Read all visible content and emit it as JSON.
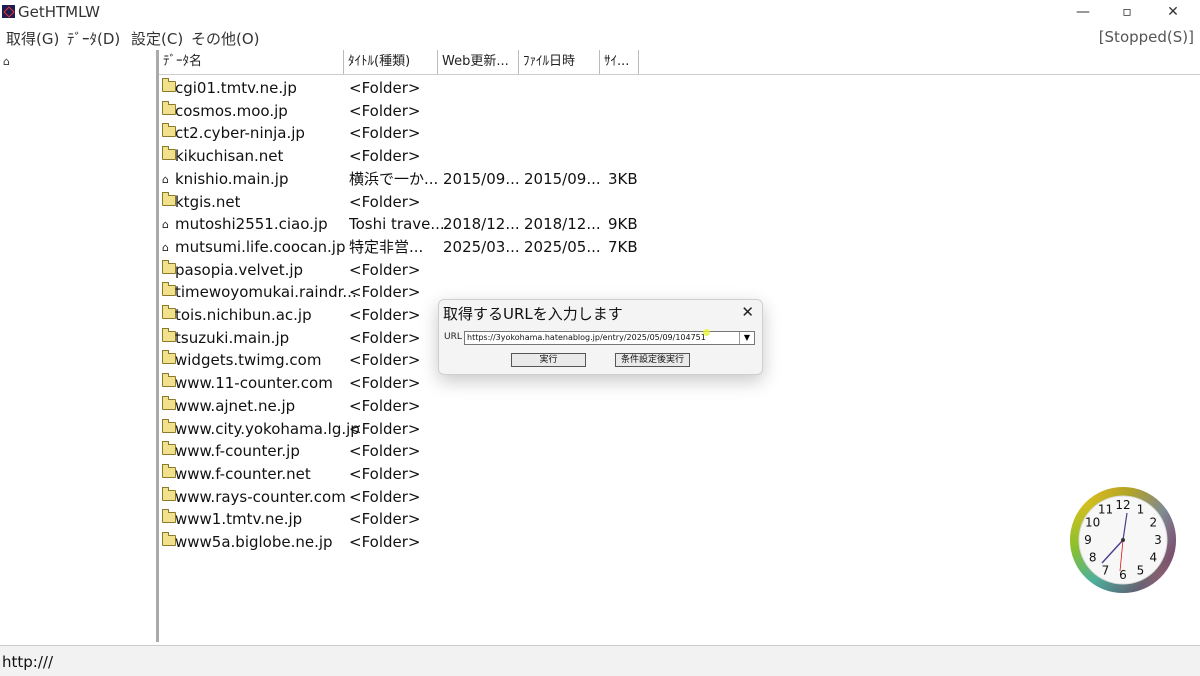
{
  "window": {
    "title": "GetHTMLW",
    "minimize": "—",
    "restore": "▫",
    "close": "✕"
  },
  "menu": {
    "items": [
      "取得(G)",
      "ﾃﾞｰﾀ(D)",
      "設定(C)",
      "その他(O)"
    ],
    "status": "[Stopped(S)]"
  },
  "list": {
    "columns": [
      "ﾃﾞｰﾀ名",
      "ﾀｲﾄﾙ(種類)",
      "Web更新...",
      "ﾌｧｲﾙ日時",
      "ｻｲ..."
    ],
    "rows": [
      {
        "name": "cgi01.tmtv.ne.jp",
        "title": "<Folder>",
        "web": "",
        "file": "",
        "size": "",
        "icon": "folder-icon"
      },
      {
        "name": "cosmos.moo.jp",
        "title": "<Folder>",
        "web": "",
        "file": "",
        "size": "",
        "icon": "folder-icon"
      },
      {
        "name": "ct2.cyber-ninja.jp",
        "title": "<Folder>",
        "web": "",
        "file": "",
        "size": "",
        "icon": "folder-icon"
      },
      {
        "name": "kikuchisan.net",
        "title": "<Folder>",
        "web": "",
        "file": "",
        "size": "",
        "icon": "folder-icon"
      },
      {
        "name": "knishio.main.jp",
        "title": "横浜で一か...",
        "web": "2015/09...",
        "file": "2015/09...",
        "size": "3KB",
        "icon": "home-icon"
      },
      {
        "name": "ktgis.net",
        "title": "<Folder>",
        "web": "",
        "file": "",
        "size": "",
        "icon": "folder-icon"
      },
      {
        "name": "mutoshi2551.ciao.jp",
        "title": "Toshi trave...",
        "web": "2018/12...",
        "file": "2018/12...",
        "size": "9KB",
        "icon": "home-icon"
      },
      {
        "name": "mutsumi.life.coocan.jp",
        "title": "特定非営...",
        "web": "2025/03...",
        "file": "2025/05...",
        "size": "7KB",
        "icon": "home-icon"
      },
      {
        "name": "pasopia.velvet.jp",
        "title": "<Folder>",
        "web": "",
        "file": "",
        "size": "",
        "icon": "folder-icon"
      },
      {
        "name": "timewoyomukai.raindr...",
        "title": "<Folder>",
        "web": "",
        "file": "",
        "size": "",
        "icon": "folder-icon"
      },
      {
        "name": "tois.nichibun.ac.jp",
        "title": "<Folder>",
        "web": "",
        "file": "",
        "size": "",
        "icon": "folder-icon"
      },
      {
        "name": "tsuzuki.main.jp",
        "title": "<Folder>",
        "web": "",
        "file": "",
        "size": "",
        "icon": "folder-icon"
      },
      {
        "name": "widgets.twimg.com",
        "title": "<Folder>",
        "web": "",
        "file": "",
        "size": "",
        "icon": "folder-icon"
      },
      {
        "name": "www.11-counter.com",
        "title": "<Folder>",
        "web": "",
        "file": "",
        "size": "",
        "icon": "folder-icon"
      },
      {
        "name": "www.ajnet.ne.jp",
        "title": "<Folder>",
        "web": "",
        "file": "",
        "size": "",
        "icon": "folder-icon"
      },
      {
        "name": "www.city.yokohama.lg.jp",
        "title": "<Folder>",
        "web": "",
        "file": "",
        "size": "",
        "icon": "folder-icon"
      },
      {
        "name": "www.f-counter.jp",
        "title": "<Folder>",
        "web": "",
        "file": "",
        "size": "",
        "icon": "folder-icon"
      },
      {
        "name": "www.f-counter.net",
        "title": "<Folder>",
        "web": "",
        "file": "",
        "size": "",
        "icon": "folder-icon"
      },
      {
        "name": "www.rays-counter.com",
        "title": "<Folder>",
        "web": "",
        "file": "",
        "size": "",
        "icon": "folder-icon"
      },
      {
        "name": "www1.tmtv.ne.jp",
        "title": "<Folder>",
        "web": "",
        "file": "",
        "size": "",
        "icon": "folder-icon"
      },
      {
        "name": "www5a.biglobe.ne.jp",
        "title": "<Folder>",
        "web": "",
        "file": "",
        "size": "",
        "icon": "folder-icon"
      }
    ]
  },
  "dialog": {
    "title": "取得するURLを入力します",
    "close": "✕",
    "url_label": "URL",
    "url_value": "https://3yokohama.hatenablog.jp/entry/2025/05/09/104751",
    "execute_label": "実行",
    "execute_after_settings_label": "条件設定後実行"
  },
  "statusbar": {
    "text": "http:///"
  },
  "clock": {
    "numbers": [
      "12",
      "1",
      "2",
      "3",
      "4",
      "5",
      "6",
      "7",
      "8",
      "9",
      "10",
      "11"
    ]
  }
}
